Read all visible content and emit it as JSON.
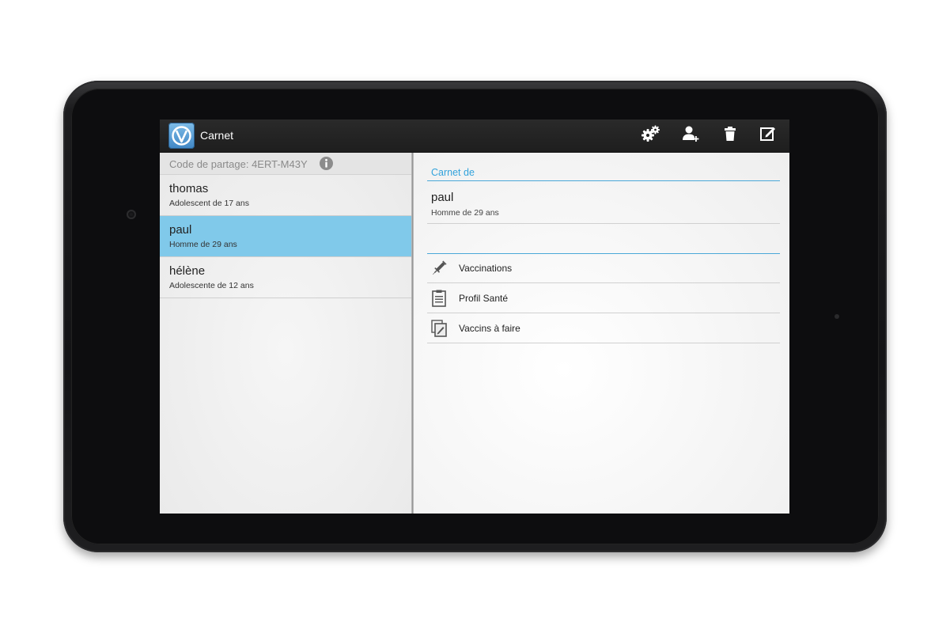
{
  "actionbar": {
    "title": "Carnet",
    "icons": [
      "settings-icon",
      "add-person-icon",
      "trash-icon",
      "edit-icon"
    ]
  },
  "sidebar": {
    "share_code": "Code de partage: 4ERT-M43Y",
    "people": [
      {
        "name": "thomas",
        "description": "Adolescent de 17 ans",
        "selected": false
      },
      {
        "name": "paul",
        "description": "Homme de 29 ans",
        "selected": true
      },
      {
        "name": "hélène",
        "description": "Adolescente de 12 ans",
        "selected": false
      }
    ]
  },
  "detail": {
    "header": "Carnet de",
    "owner_name": "paul",
    "owner_description": "Homme de 29 ans",
    "menu": [
      {
        "label": "Vaccinations",
        "icon": "syringe-icon"
      },
      {
        "label": "Profil Santé",
        "icon": "clipboard-icon"
      },
      {
        "label": "Vaccins à faire",
        "icon": "notes-edit-icon"
      }
    ]
  },
  "colors": {
    "accent": "#33a3dc",
    "selected_row": "#80c9ea",
    "actionbar": "#222222"
  }
}
